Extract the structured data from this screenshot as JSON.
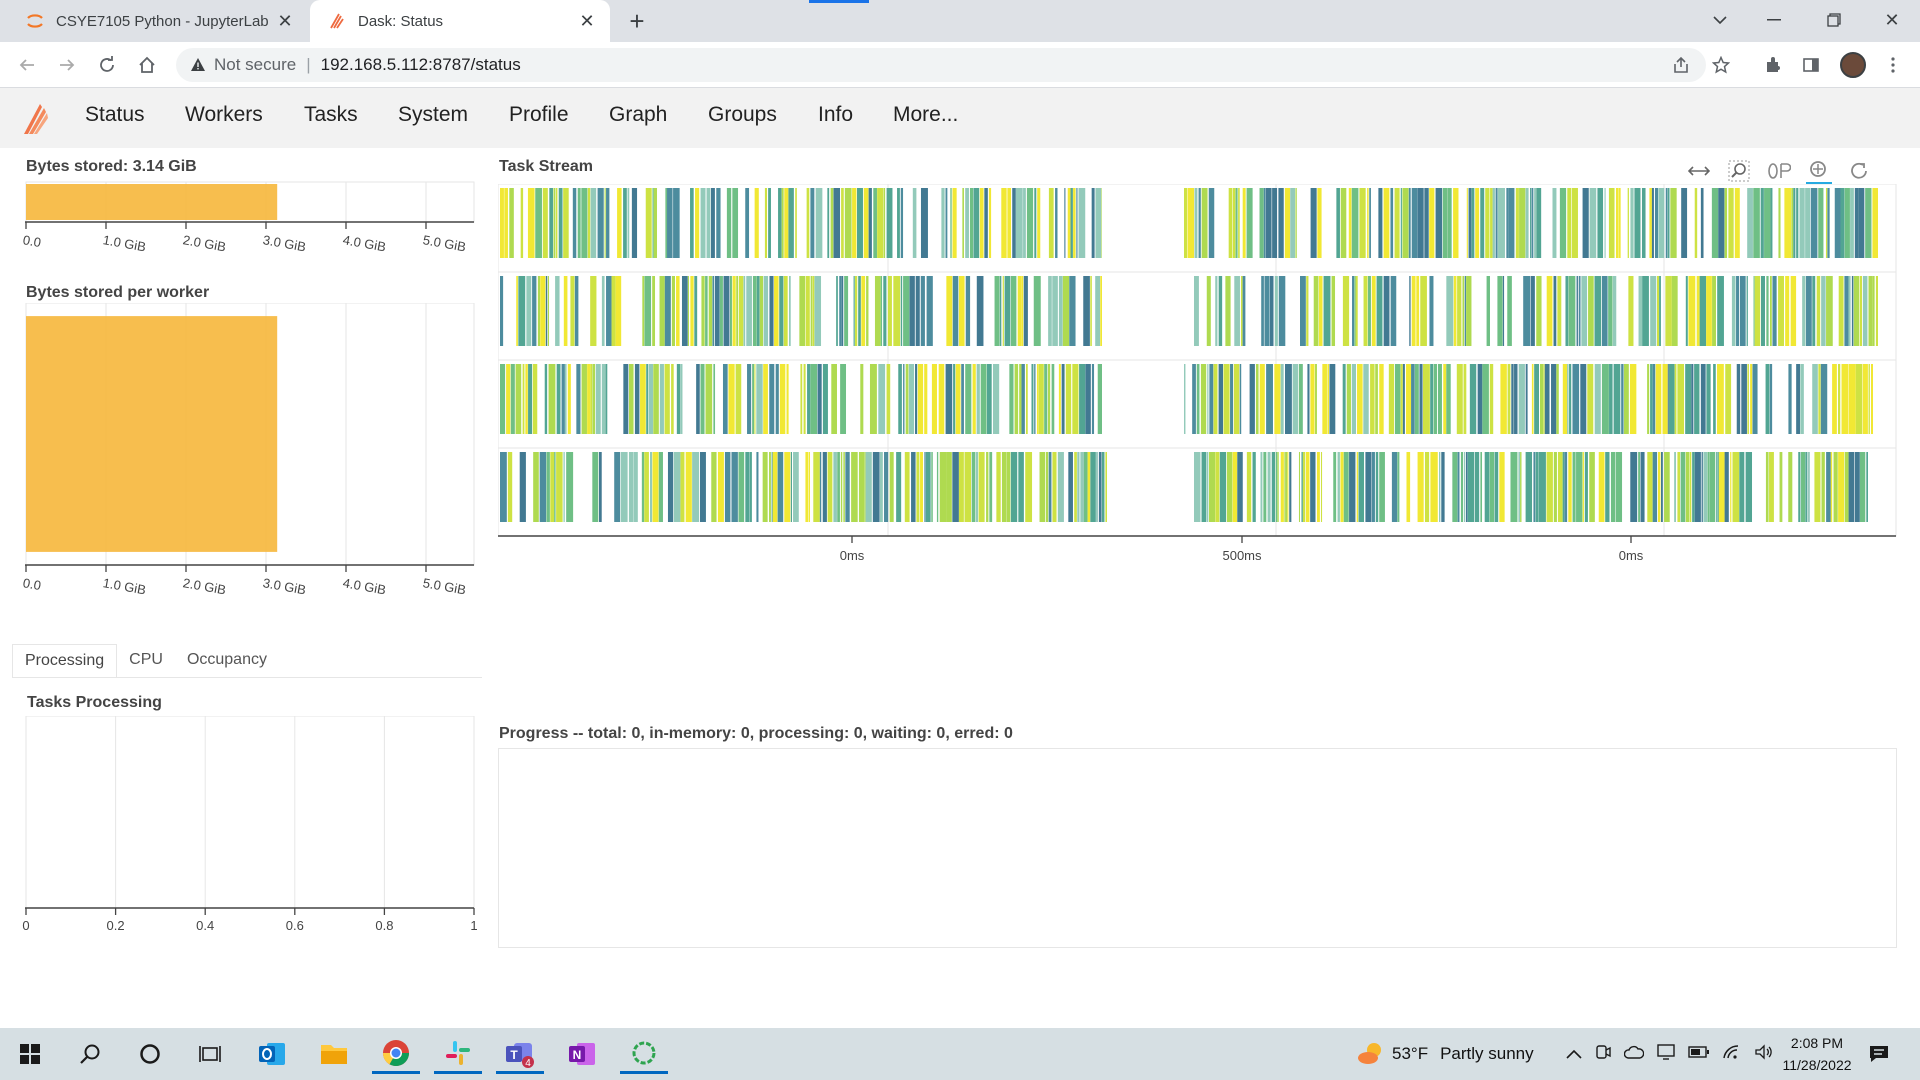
{
  "browser": {
    "tabs": [
      {
        "title": "CSYE7105 Python - JupyterLab",
        "active": false
      },
      {
        "title": "Dask: Status",
        "active": true
      }
    ],
    "omnibox": {
      "security_label": "Not secure",
      "url": "192.168.5.112:8787/status"
    }
  },
  "dasknav": {
    "items": [
      "Status",
      "Workers",
      "Tasks",
      "System",
      "Profile",
      "Graph",
      "Groups",
      "Info",
      "More..."
    ]
  },
  "panels": {
    "bytes_stored_title": "Bytes stored: 3.14 GiB",
    "bytes_per_worker_title": "Bytes stored per worker",
    "tabs": [
      "Processing",
      "CPU",
      "Occupancy"
    ],
    "tasks_processing_title": "Tasks Processing",
    "task_stream_title": "Task Stream",
    "progress_title": "Progress -- total: 0, in-memory: 0, processing: 0, waiting: 0, erred: 0"
  },
  "chart_data": [
    {
      "type": "bar",
      "title": "Bytes stored: 3.14 GiB",
      "orientation": "horizontal",
      "values": [
        3.14
      ],
      "xlim": [
        0,
        5.6
      ],
      "xticks": [
        "0.0",
        "1.0 GiB",
        "2.0 GiB",
        "3.0 GiB",
        "4.0 GiB",
        "5.0 GiB"
      ],
      "color": "#f6b83f"
    },
    {
      "type": "bar",
      "title": "Bytes stored per worker",
      "orientation": "horizontal",
      "values": [
        3.14
      ],
      "xlim": [
        0,
        5.6
      ],
      "xticks": [
        "0.0",
        "1.0 GiB",
        "2.0 GiB",
        "3.0 GiB",
        "4.0 GiB",
        "5.0 GiB"
      ],
      "color": "#f6b83f"
    },
    {
      "type": "bar",
      "title": "Tasks Processing",
      "values": [],
      "xlim": [
        0,
        1
      ],
      "xticks": [
        "0",
        "0.2",
        "0.4",
        "0.6",
        "0.8",
        "1"
      ]
    },
    {
      "type": "scatter",
      "title": "Task Stream",
      "workers": 4,
      "xticks": [
        "0ms",
        "500ms",
        "0ms"
      ],
      "colors": [
        "#f0e51e",
        "#c9df2f",
        "#a6d63d",
        "#5fb878",
        "#3f9b87",
        "#3a7f93",
        "#2e6a86",
        "#87c4b2"
      ]
    }
  ],
  "taskbar": {
    "weather": {
      "temp": "53°F",
      "desc": "Partly sunny"
    },
    "clock": {
      "time": "2:08 PM",
      "date": "11/28/2022"
    },
    "teams_badge": "4"
  },
  "colors": {
    "bar": "#f6b83f",
    "bar_border": "#eaa62a",
    "axis": "#444444",
    "grid": "#e6e6e6"
  }
}
